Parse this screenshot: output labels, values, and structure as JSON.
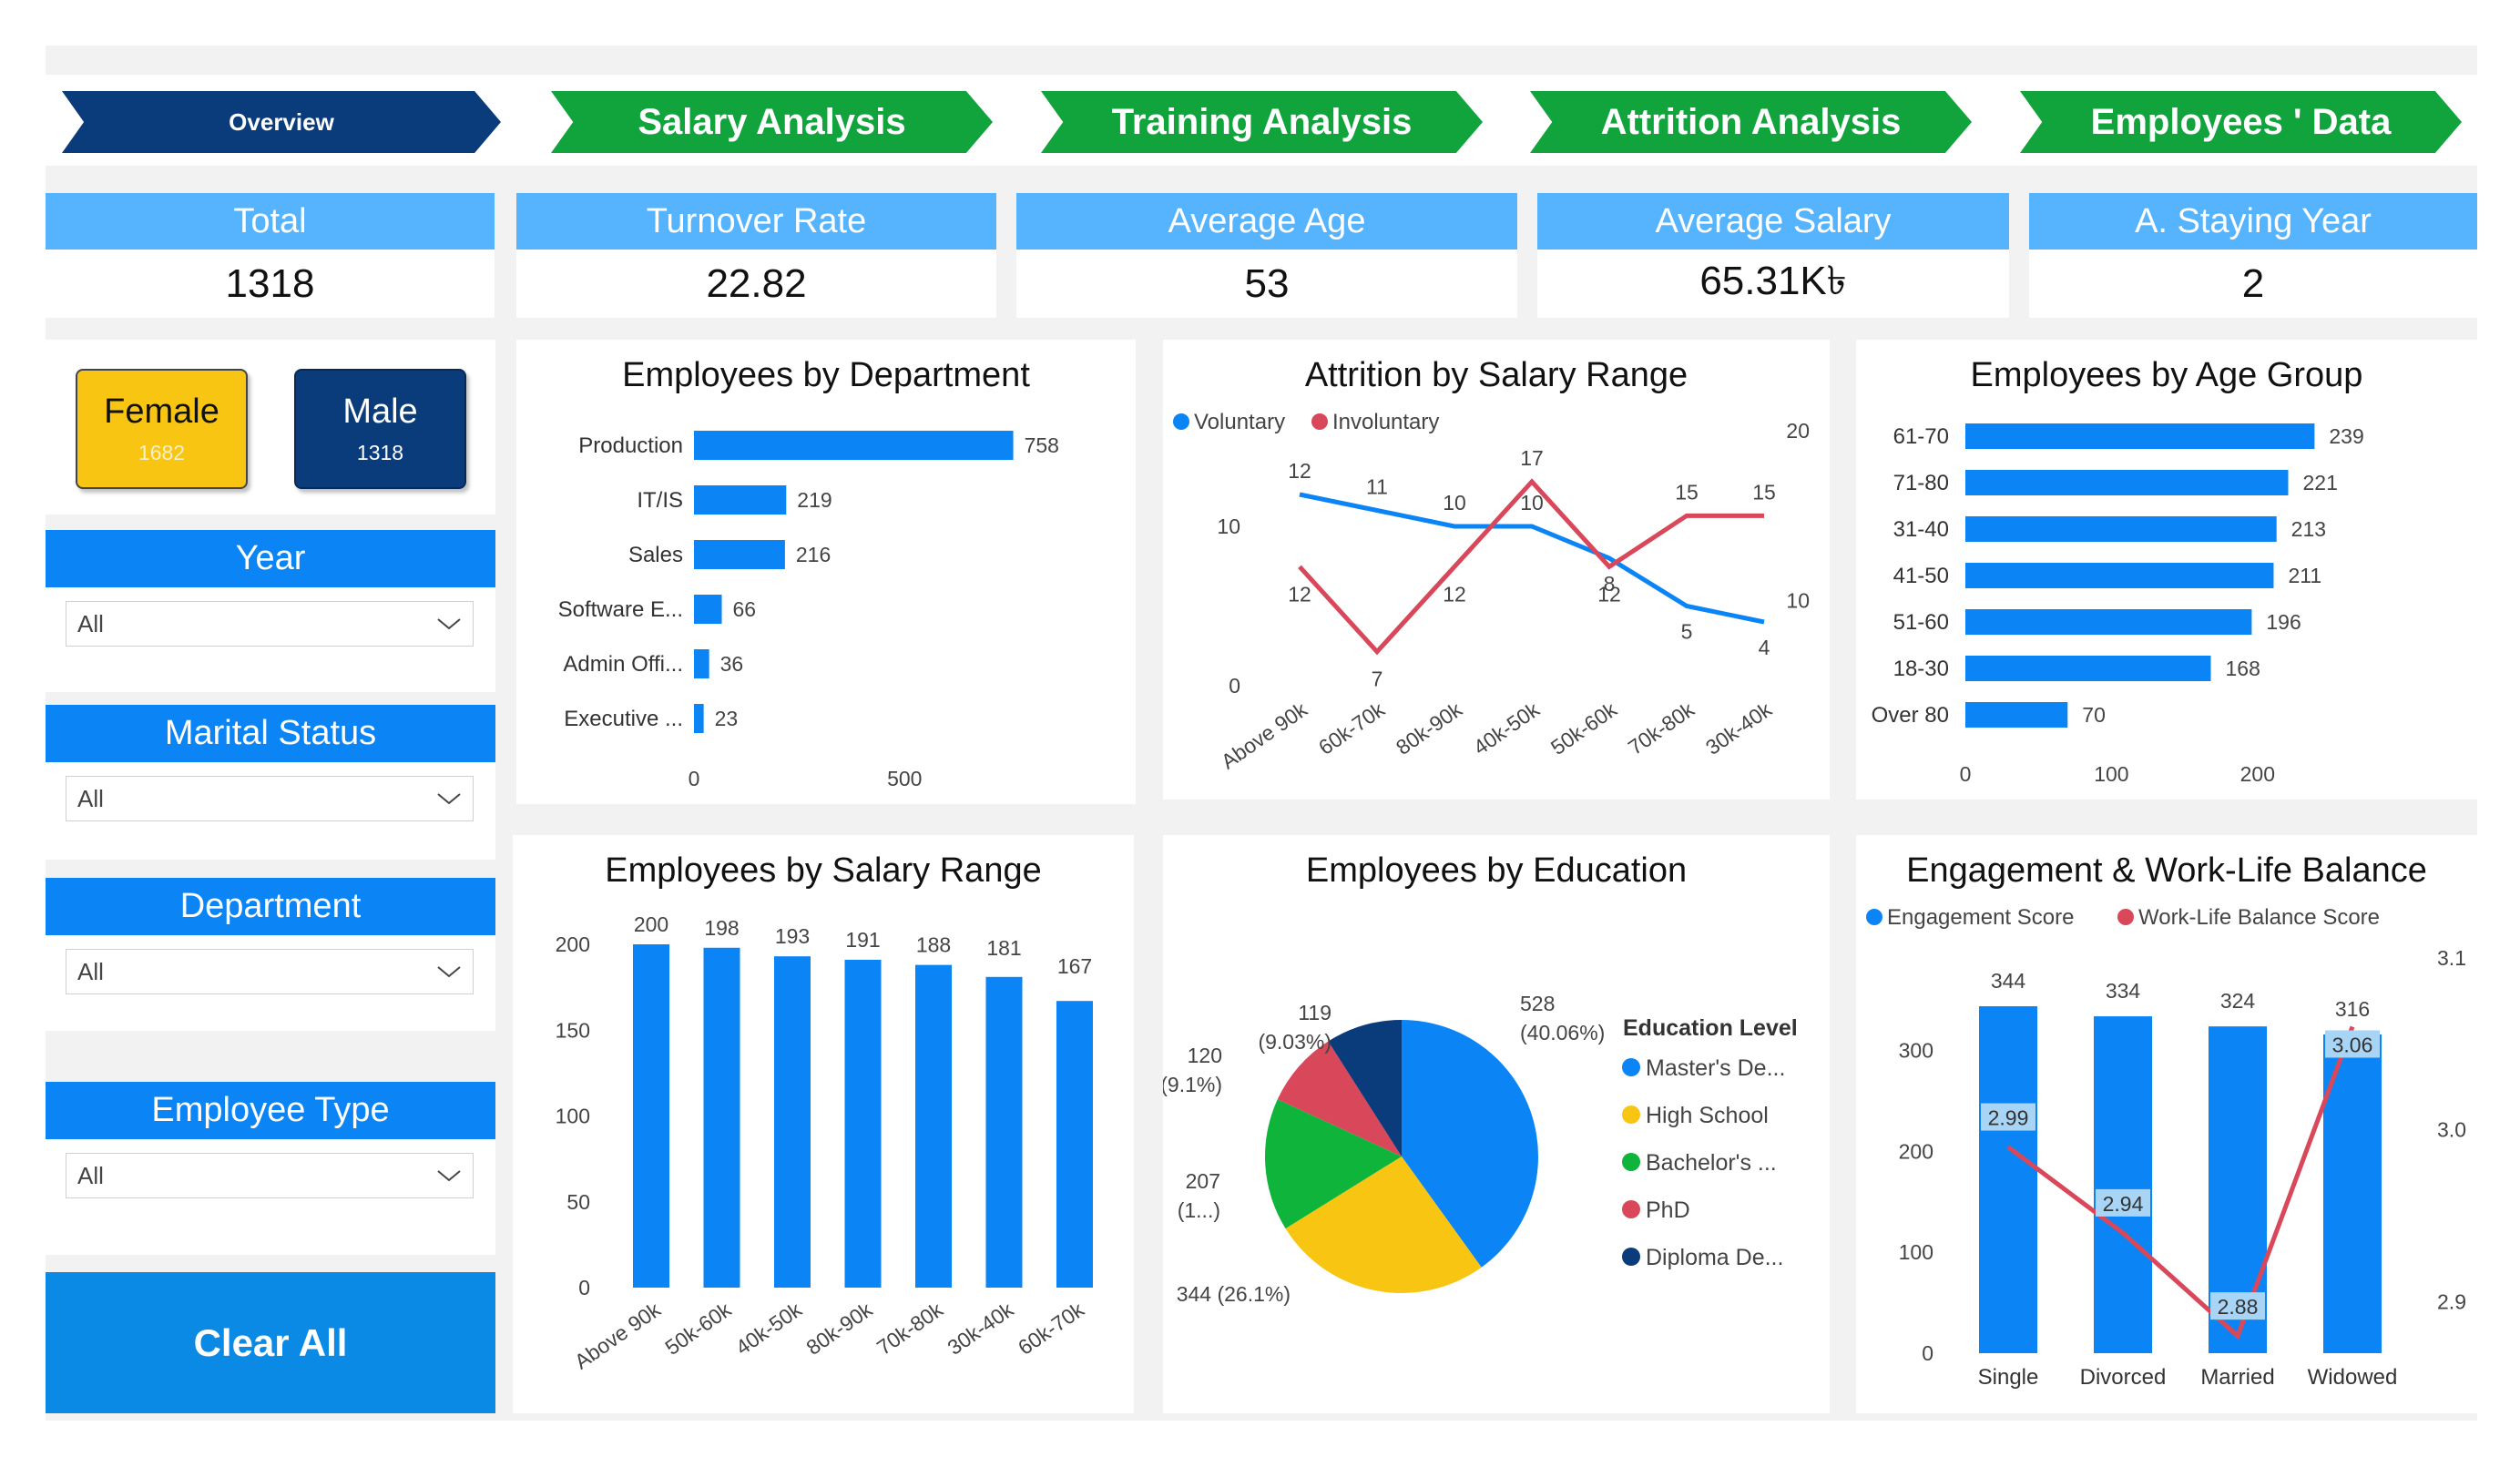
{
  "colors": {
    "navy": "#0a3b7a",
    "green": "#12a43c",
    "blue": "#0b84f5",
    "light_blue": "#56b4ff",
    "red": "#d9485a",
    "yellow": "#f9c513",
    "bright_green": "#0fb43a"
  },
  "nav": {
    "overview": "Overview",
    "salary": "Salary Analysis",
    "training": "Training Analysis",
    "attrition": "Attrition Analysis",
    "employees": "Employees ' Data"
  },
  "kpis": {
    "total": {
      "label": "Total",
      "value": "1318"
    },
    "turnover": {
      "label": "Turnover Rate",
      "value": "22.82"
    },
    "age": {
      "label": "Average Age",
      "value": "53"
    },
    "salary": {
      "label": "Average Salary",
      "value": "65.31K৳"
    },
    "staying": {
      "label": "A. Staying Year",
      "value": "2"
    }
  },
  "gender": {
    "female": {
      "label": "Female",
      "count": "1682"
    },
    "male": {
      "label": "Male",
      "count": "1318"
    }
  },
  "slicers": {
    "year": {
      "label": "Year",
      "value": "All"
    },
    "marital": {
      "label": "Marital Status",
      "value": "All"
    },
    "department": {
      "label": "Department",
      "value": "All"
    },
    "emp_type": {
      "label": "Employee Type",
      "value": "All"
    }
  },
  "clear_all": "Clear All",
  "chart_data": [
    {
      "type": "bar",
      "orientation": "horizontal",
      "title": "Employees by Department",
      "categories": [
        "Production",
        "IT/IS",
        "Sales",
        "Software E...",
        "Admin Offi...",
        "Executive ..."
      ],
      "values": [
        758,
        219,
        216,
        66,
        36,
        23
      ],
      "xticks": [
        "0",
        "500"
      ],
      "xlim": [
        0,
        800
      ]
    },
    {
      "type": "line",
      "title": "Attrition by Salary Range",
      "categories": [
        "Above 90k",
        "60k-70k",
        "80k-90k",
        "40k-50k",
        "50k-60k",
        "70k-80k",
        "30k-40k"
      ],
      "series": [
        {
          "name": "Voluntary",
          "values": [
            12,
            11,
            10,
            10,
            8,
            5,
            4
          ],
          "axis": "left"
        },
        {
          "name": "Involuntary",
          "values": [
            12,
            7,
            12,
            17,
            12,
            15,
            15
          ],
          "axis": "right"
        }
      ],
      "y_left_ticks": [
        "0",
        "10"
      ],
      "y_left_lim": [
        0,
        16
      ],
      "y_right_ticks": [
        "10",
        "20"
      ],
      "y_right_lim": [
        5,
        20
      ],
      "legend": "top-left"
    },
    {
      "type": "bar",
      "orientation": "horizontal",
      "title": "Employees by Age Group",
      "categories": [
        "61-70",
        "71-80",
        "31-40",
        "41-50",
        "51-60",
        "18-30",
        "Over 80"
      ],
      "values": [
        239,
        221,
        213,
        211,
        196,
        168,
        70
      ],
      "xticks": [
        "0",
        "100",
        "200"
      ],
      "xlim": [
        0,
        245
      ]
    },
    {
      "type": "bar",
      "title": "Employees by Salary Range",
      "categories": [
        "Above 90k",
        "50k-60k",
        "40k-50k",
        "80k-90k",
        "70k-80k",
        "30k-40k",
        "60k-70k"
      ],
      "values": [
        200,
        198,
        193,
        191,
        188,
        181,
        167
      ],
      "yticks": [
        "0",
        "50",
        "100",
        "150",
        "200"
      ],
      "ylim": [
        0,
        200
      ]
    },
    {
      "type": "pie",
      "title": "Employees by Education",
      "legend_title": "Education Level",
      "slices": [
        {
          "name": "Master's De...",
          "value": 528,
          "label": "528 (40.06%)",
          "color": "#0b84f5"
        },
        {
          "name": "High School",
          "value": 344,
          "label": "344 (26.1%)",
          "color": "#f9c513"
        },
        {
          "name": "Bachelor's ...",
          "value": 207,
          "label": "207 (1...)",
          "color": "#0fb43a"
        },
        {
          "name": "PhD",
          "value": 120,
          "label": "120 (9.1%)",
          "color": "#d9485a"
        },
        {
          "name": "Diploma De...",
          "value": 119,
          "label": "119 (9.03%)",
          "color": "#0a3b7a"
        }
      ],
      "legend": "right"
    },
    {
      "type": "bar",
      "title": "Engagement & Work-Life Balance",
      "categories": [
        "Single",
        "Divorced",
        "Married",
        "Widowed"
      ],
      "series": [
        {
          "name": "Engagement Score",
          "type": "bar",
          "values": [
            344,
            334,
            324,
            316
          ],
          "axis": "left"
        },
        {
          "name": "Work-Life Balance Score",
          "type": "line",
          "values": [
            2.99,
            2.94,
            2.88,
            3.06
          ],
          "axis": "right"
        }
      ],
      "y_left_ticks": [
        "0",
        "100",
        "200",
        "300"
      ],
      "y_left_lim": [
        0,
        344
      ],
      "y_right_ticks": [
        "2.9",
        "3.0",
        "3.1"
      ],
      "y_right_lim": [
        2.87,
        3.1
      ],
      "legend": "top-left"
    }
  ]
}
